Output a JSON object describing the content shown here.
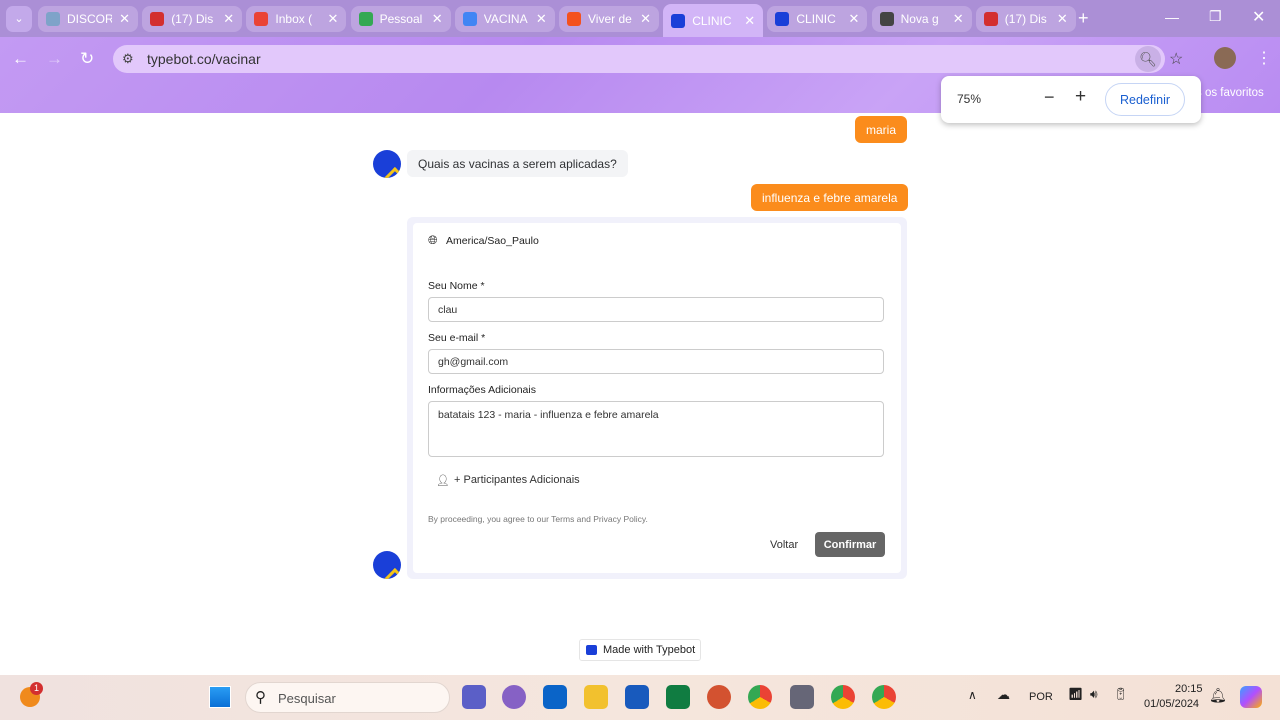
{
  "browser": {
    "tabs": [
      {
        "label": "DISCOR",
        "color": "#7ea3c9"
      },
      {
        "label": "(17) Dis",
        "color": "#d32f2f"
      },
      {
        "label": "Inbox (",
        "color": "#ea4335"
      },
      {
        "label": "Pessoal",
        "color": "#34a853"
      },
      {
        "label": "VACINA",
        "color": "#4285f4"
      },
      {
        "label": "Viver de",
        "color": "#f4511e"
      },
      {
        "label": "CLINIC",
        "color": "#1a3fd8",
        "active": true
      },
      {
        "label": "CLINIC",
        "color": "#1a3fd8"
      },
      {
        "label": "Nova g",
        "color": "#444"
      },
      {
        "label": "(17) Dis",
        "color": "#d32f2f"
      }
    ],
    "url": "typebot.co/vacinar",
    "bookmarks_text": "s os favoritos",
    "zoom": {
      "level": "75%",
      "minus": "−",
      "plus": "+",
      "reset": "Redefinir"
    }
  },
  "chat": {
    "user_msg_1": "maria",
    "bot_question": "Quais as vacinas a serem aplicadas?",
    "user_msg_2": "influenza e febre amarela",
    "form": {
      "timezone": "America/Sao_Paulo",
      "name_label": "Seu Nome *",
      "name_value": "clau",
      "email_label": "Seu e-mail *",
      "email_value": "gh@gmail.com",
      "info_label": "Informações Adicionais",
      "info_value": "batatais 123 - maria - influenza e febre amarela",
      "participants": "+ Participantes Adicionais",
      "consent": "By proceeding, you agree to our Terms and Privacy Policy.",
      "back": "Voltar",
      "confirm": "Confirmar"
    },
    "made_with": "Made with Typebot"
  },
  "taskbar": {
    "search": "Pesquisar",
    "lang": "POR",
    "time": "20:15",
    "date": "01/05/2024",
    "badge": "1"
  }
}
